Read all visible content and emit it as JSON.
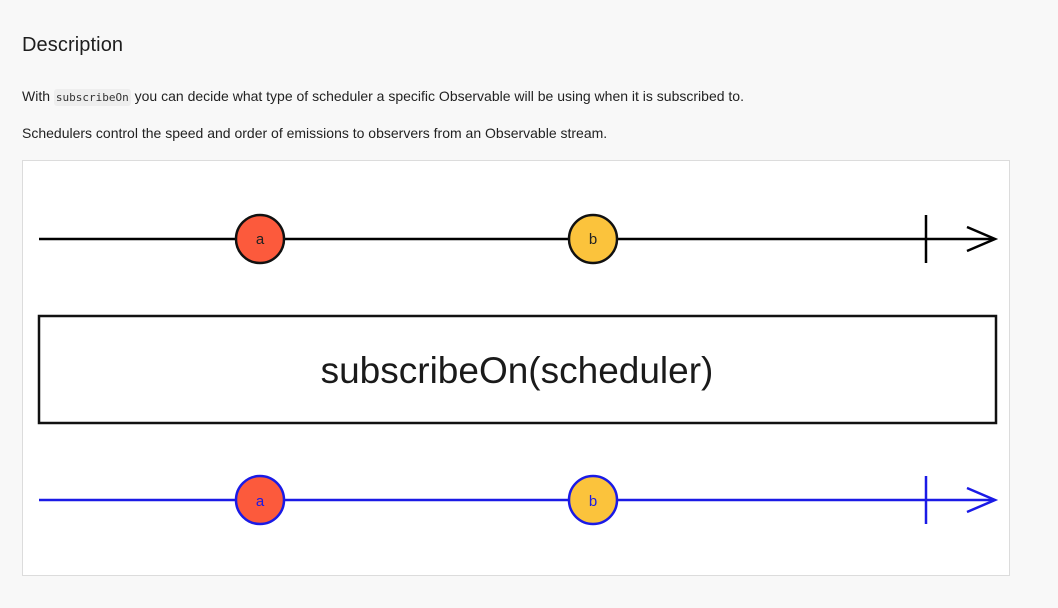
{
  "section": {
    "title": "Description"
  },
  "paragraph1": {
    "before": "With ",
    "code": "subscribeOn",
    "after": " you can decide what type of scheduler a specific Observable will be using when it is subscribed to."
  },
  "paragraph2": {
    "text": "Schedulers control the speed and order of emissions to observers from an Observable stream."
  },
  "diagram": {
    "operator_label": "subscribeOn(scheduler)",
    "input_stream": {
      "color": "#000000",
      "marbles": [
        {
          "label": "a",
          "fill": "#fc5a3c"
        },
        {
          "label": "b",
          "fill": "#fbc33c"
        }
      ]
    },
    "output_stream": {
      "color": "#1a1ae6",
      "marbles": [
        {
          "label": "a",
          "fill": "#fc5a3c"
        },
        {
          "label": "b",
          "fill": "#fbc33c"
        }
      ]
    }
  }
}
